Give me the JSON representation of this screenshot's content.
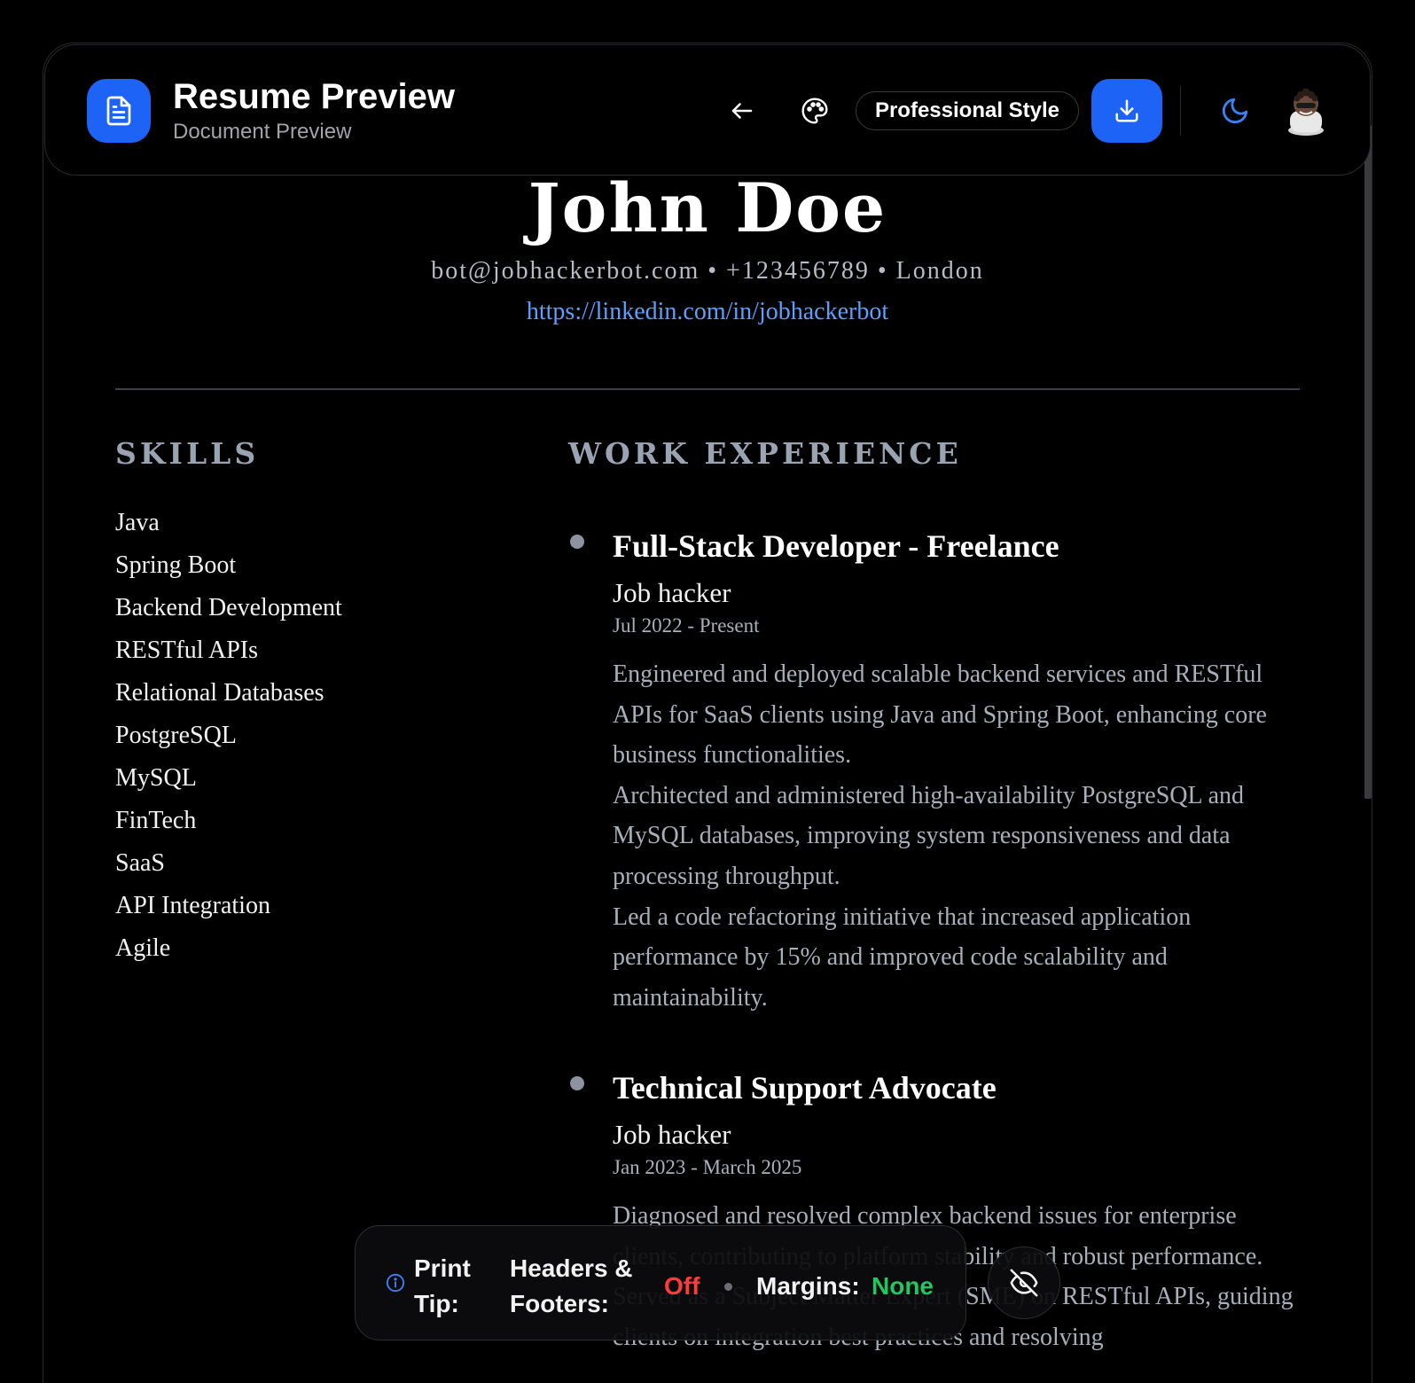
{
  "header": {
    "title": "Resume Preview",
    "subtitle": "Document Preview",
    "style_label": "Professional Style",
    "icons": [
      "document-icon",
      "arrow-left-icon",
      "palette-icon",
      "download-icon",
      "moon-icon",
      "avatar"
    ],
    "accent_color": "#1d63f5"
  },
  "resume": {
    "name": "John Doe",
    "contact": "bot@jobhackerbot.com • +123456789 • London",
    "linkedin": "https://linkedin.com/in/jobhackerbot",
    "skills_title": "SKILLS",
    "skills": [
      "Java",
      "Spring Boot",
      "Backend Development",
      "RESTful APIs",
      "Relational Databases",
      "PostgreSQL",
      "MySQL",
      "FinTech",
      "SaaS",
      "API Integration",
      "Agile"
    ],
    "work_title": "WORK EXPERIENCE",
    "jobs": [
      {
        "title": "Full-Stack Developer - Freelance",
        "company": "Job hacker",
        "dates": "Jul 2022 - Present",
        "bullets": [
          "Engineered and deployed scalable backend services and RESTful APIs for SaaS clients using Java and Spring Boot, enhancing core business functionalities.",
          "Architected and administered high-availability PostgreSQL and MySQL databases, improving system responsiveness and data processing throughput.",
          "Led a code refactoring initiative that increased application performance by 15% and improved code scalability and maintainability."
        ]
      },
      {
        "title": "Technical Support Advocate",
        "company": "Job hacker",
        "dates": "Jan 2023 - March 2025",
        "bullets": [
          "Diagnosed and resolved complex backend issues for enterprise clients, contributing to platform stability and robust performance.",
          "Served as a Subject Matter Expert (SME) on RESTful APIs, guiding clients on integration best practices and resolving"
        ]
      }
    ]
  },
  "print_tip": {
    "label": "Print Tip:",
    "headers_label": "Headers & Footers:",
    "headers_value": "Off",
    "margins_label": "Margins:",
    "margins_value": "None",
    "off_color": "#ff3b3b",
    "none_color": "#22c55e"
  }
}
